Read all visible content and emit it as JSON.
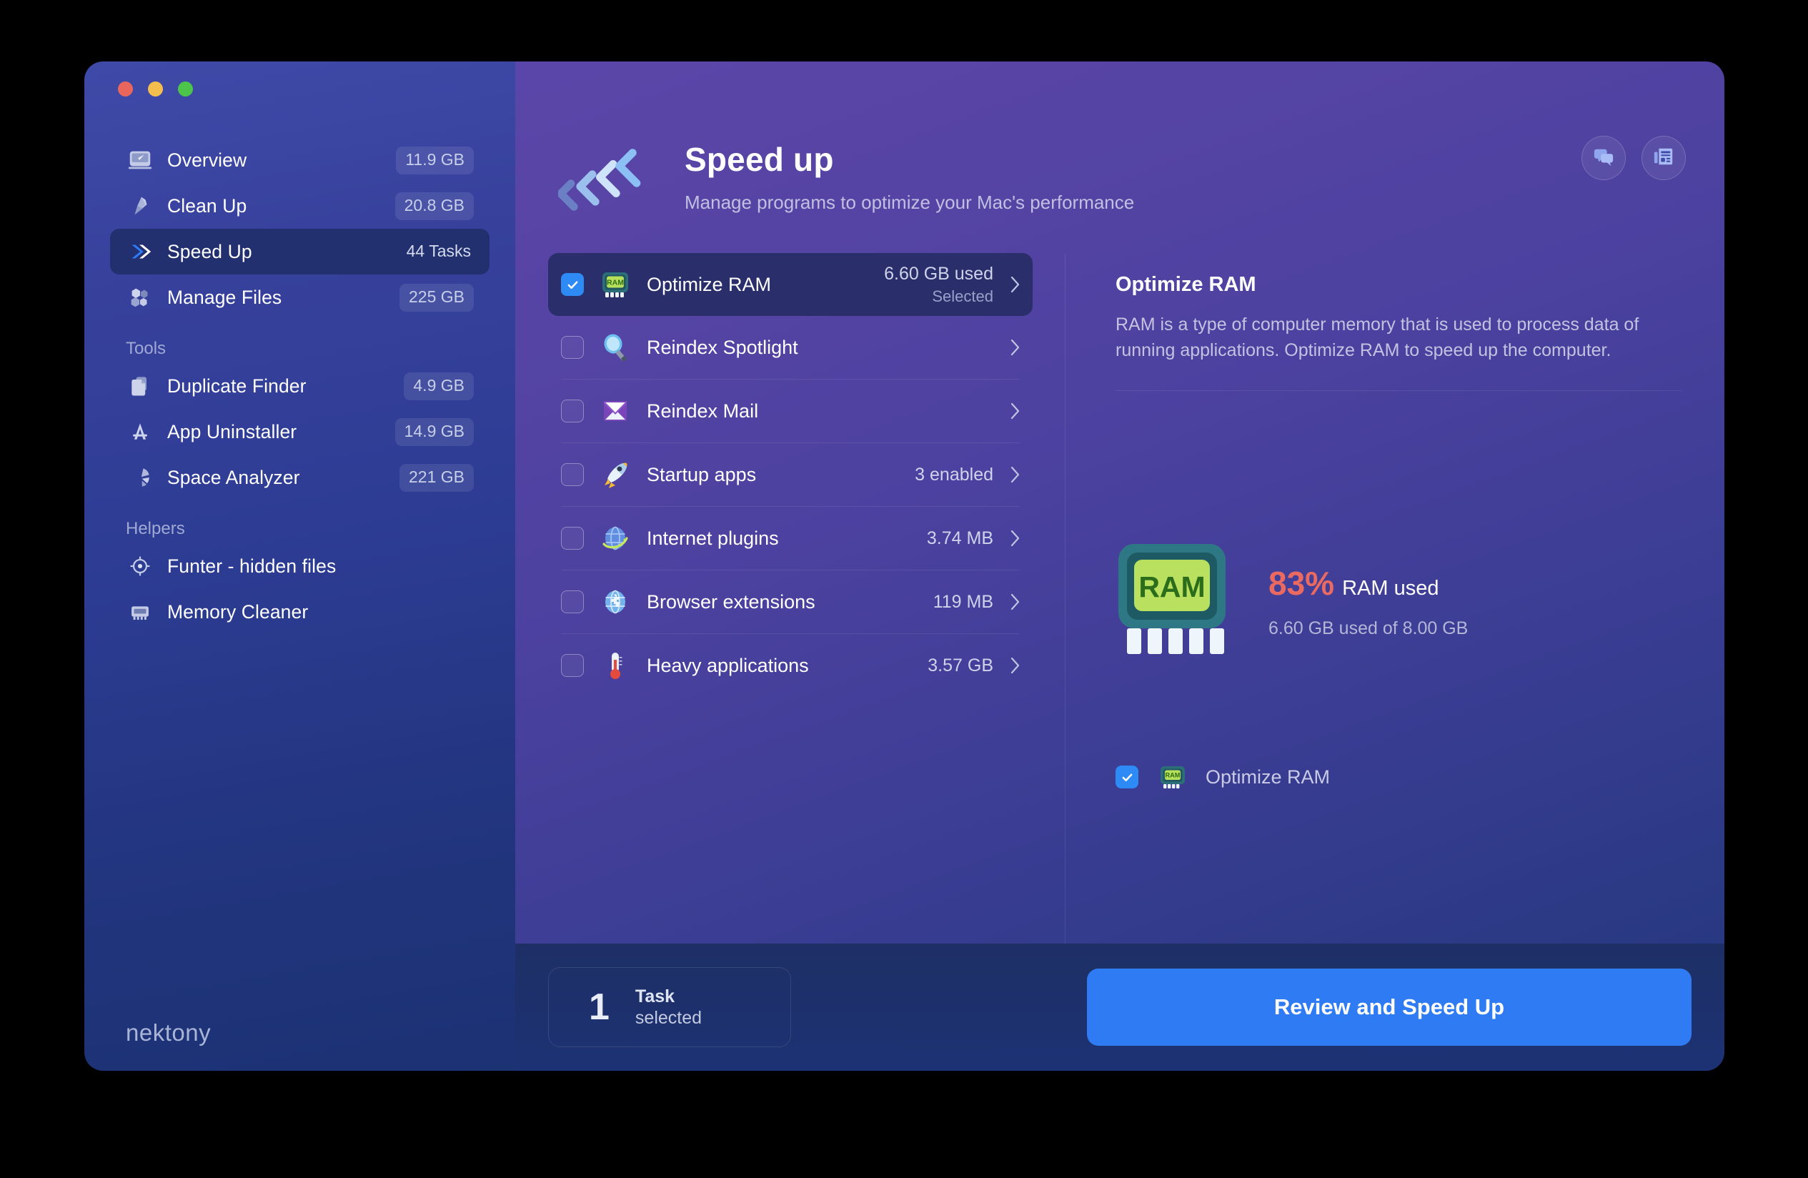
{
  "window": {
    "traffic_lights": [
      "close",
      "minimize",
      "zoom"
    ],
    "brand": "nektony"
  },
  "sidebar": {
    "primary": [
      {
        "label": "Overview",
        "badge": "11.9 GB",
        "icon": "gauge-icon",
        "selected": false
      },
      {
        "label": "Clean Up",
        "badge": "20.8 GB",
        "icon": "broom-icon",
        "selected": false
      },
      {
        "label": "Speed Up",
        "badge": "44 Tasks",
        "icon": "double-chevron-icon",
        "selected": true
      },
      {
        "label": "Manage Files",
        "badge": "225 GB",
        "icon": "hexagons-icon",
        "selected": false
      }
    ],
    "tools_header": "Tools",
    "tools": [
      {
        "label": "Duplicate Finder",
        "badge": "4.9 GB",
        "icon": "documents-icon",
        "selected": false
      },
      {
        "label": "App Uninstaller",
        "badge": "14.9 GB",
        "icon": "app-store-icon",
        "selected": false
      },
      {
        "label": "Space Analyzer",
        "badge": "221 GB",
        "icon": "pie-chart-icon",
        "selected": false
      }
    ],
    "helpers_header": "Helpers",
    "helpers": [
      {
        "label": "Funter - hidden files",
        "badge": "",
        "icon": "target-icon",
        "selected": false
      },
      {
        "label": "Memory Cleaner",
        "badge": "",
        "icon": "memory-chip-icon",
        "selected": false
      }
    ]
  },
  "header": {
    "logo": "speed-up-chevrons-icon",
    "title": "Speed up",
    "subtitle": "Manage programs to optimize your Mac's performance",
    "actions": [
      {
        "name": "feedback-icon",
        "label": "Feedback"
      },
      {
        "name": "news-icon",
        "label": "News"
      }
    ]
  },
  "tasks": [
    {
      "label": "Optimize RAM",
      "icon": "ram-chip-icon",
      "meta1": "6.60 GB used",
      "meta2": "Selected",
      "checked": true,
      "selected": true
    },
    {
      "label": "Reindex Spotlight",
      "icon": "magnifier-icon",
      "meta1": "",
      "meta2": "",
      "checked": false,
      "selected": false
    },
    {
      "label": "Reindex Mail",
      "icon": "mail-envelope-icon",
      "meta1": "",
      "meta2": "",
      "checked": false,
      "selected": false
    },
    {
      "label": "Startup apps",
      "icon": "rocket-icon",
      "meta1": "3 enabled",
      "meta2": "",
      "checked": false,
      "selected": false
    },
    {
      "label": "Internet plugins",
      "icon": "globe-arrow-icon",
      "meta1": "3.74 MB",
      "meta2": "",
      "checked": false,
      "selected": false
    },
    {
      "label": "Browser extensions",
      "icon": "globe-puzzle-icon",
      "meta1": "119 MB",
      "meta2": "",
      "checked": false,
      "selected": false
    },
    {
      "label": "Heavy applications",
      "icon": "thermometer-icon",
      "meta1": "3.57 GB",
      "meta2": "",
      "checked": false,
      "selected": false
    }
  ],
  "detail": {
    "title": "Optimize RAM",
    "description": "RAM is a type of computer memory that is used to process data of running applications. Optimize RAM to speed up the computer.",
    "chip_label": "RAM",
    "ram_percent": "83%",
    "ram_percent_label": "RAM used",
    "ram_detail": "6.60 GB used of 8.00 GB",
    "option_label": "Optimize RAM",
    "option_checked": true
  },
  "footer": {
    "count": "1",
    "count_line1": "Task",
    "count_line2": "selected",
    "action_label": "Review and Speed Up"
  },
  "colors": {
    "accent_blue": "#2f7bf3",
    "checkbox_blue": "#2e8af5",
    "alert_red": "#ea6a62",
    "selected_row": "#2a2f6b",
    "sidebar_selected": "#22306f",
    "bottom_bar": "#1d3274"
  }
}
